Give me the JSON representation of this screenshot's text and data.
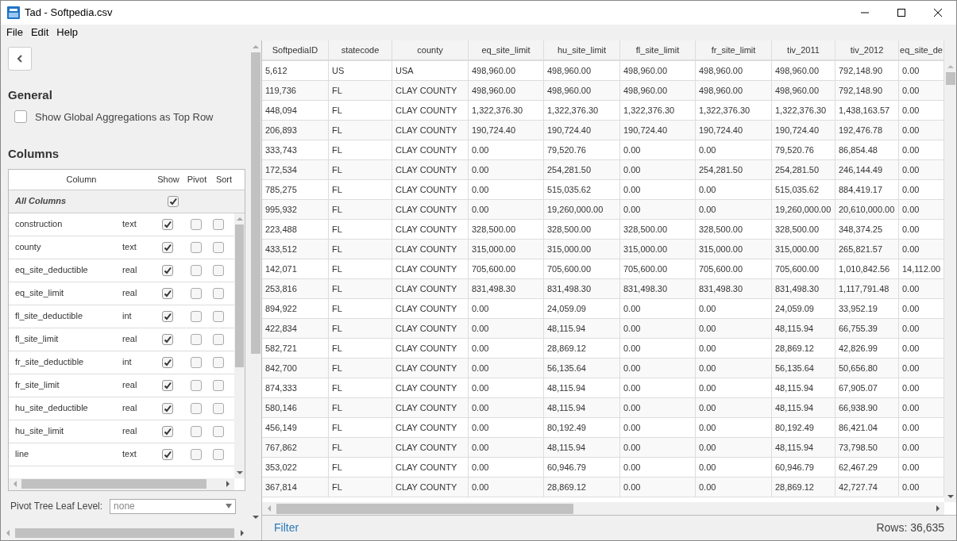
{
  "window": {
    "title": "Tad - Softpedia.csv"
  },
  "menu": [
    "File",
    "Edit",
    "Help"
  ],
  "sidebar": {
    "general": {
      "heading": "General",
      "option": {
        "label": "Show Global Aggregations as Top Row",
        "checked": false
      }
    },
    "columns": {
      "heading": "Columns",
      "headers": [
        "Column",
        "Show",
        "Pivot",
        "Sort"
      ],
      "all": {
        "label": "All Columns",
        "show": true
      },
      "items": [
        {
          "name": "construction",
          "type": "text",
          "show": true,
          "pivot": false,
          "sort": false
        },
        {
          "name": "county",
          "type": "text",
          "show": true,
          "pivot": false,
          "sort": false
        },
        {
          "name": "eq_site_deductible",
          "type": "real",
          "show": true,
          "pivot": false,
          "sort": false
        },
        {
          "name": "eq_site_limit",
          "type": "real",
          "show": true,
          "pivot": false,
          "sort": false
        },
        {
          "name": "fl_site_deductible",
          "type": "int",
          "show": true,
          "pivot": false,
          "sort": false
        },
        {
          "name": "fl_site_limit",
          "type": "real",
          "show": true,
          "pivot": false,
          "sort": false
        },
        {
          "name": "fr_site_deductible",
          "type": "int",
          "show": true,
          "pivot": false,
          "sort": false
        },
        {
          "name": "fr_site_limit",
          "type": "real",
          "show": true,
          "pivot": false,
          "sort": false
        },
        {
          "name": "hu_site_deductible",
          "type": "real",
          "show": true,
          "pivot": false,
          "sort": false
        },
        {
          "name": "hu_site_limit",
          "type": "real",
          "show": true,
          "pivot": false,
          "sort": false
        },
        {
          "name": "line",
          "type": "text",
          "show": true,
          "pivot": false,
          "sort": false
        }
      ]
    },
    "leaf_level": {
      "label": "Pivot Tree Leaf Level:",
      "value": "none"
    }
  },
  "table": {
    "columns": [
      "SoftpediaID",
      "statecode",
      "county",
      "eq_site_limit",
      "hu_site_limit",
      "fl_site_limit",
      "fr_site_limit",
      "tiv_2011",
      "tiv_2012",
      "eq_site_de"
    ],
    "rows": [
      [
        "5,612",
        "US",
        "USA",
        "498,960.00",
        "498,960.00",
        "498,960.00",
        "498,960.00",
        "498,960.00",
        "792,148.90",
        "0.00"
      ],
      [
        "119,736",
        "FL",
        "CLAY COUNTY",
        "498,960.00",
        "498,960.00",
        "498,960.00",
        "498,960.00",
        "498,960.00",
        "792,148.90",
        "0.00"
      ],
      [
        "448,094",
        "FL",
        "CLAY COUNTY",
        "1,322,376.30",
        "1,322,376.30",
        "1,322,376.30",
        "1,322,376.30",
        "1,322,376.30",
        "1,438,163.57",
        "0.00"
      ],
      [
        "206,893",
        "FL",
        "CLAY COUNTY",
        "190,724.40",
        "190,724.40",
        "190,724.40",
        "190,724.40",
        "190,724.40",
        "192,476.78",
        "0.00"
      ],
      [
        "333,743",
        "FL",
        "CLAY COUNTY",
        "0.00",
        "79,520.76",
        "0.00",
        "0.00",
        "79,520.76",
        "86,854.48",
        "0.00"
      ],
      [
        "172,534",
        "FL",
        "CLAY COUNTY",
        "0.00",
        "254,281.50",
        "0.00",
        "254,281.50",
        "254,281.50",
        "246,144.49",
        "0.00"
      ],
      [
        "785,275",
        "FL",
        "CLAY COUNTY",
        "0.00",
        "515,035.62",
        "0.00",
        "0.00",
        "515,035.62",
        "884,419.17",
        "0.00"
      ],
      [
        "995,932",
        "FL",
        "CLAY COUNTY",
        "0.00",
        "19,260,000.00",
        "0.00",
        "0.00",
        "19,260,000.00",
        "20,610,000.00",
        "0.00"
      ],
      [
        "223,488",
        "FL",
        "CLAY COUNTY",
        "328,500.00",
        "328,500.00",
        "328,500.00",
        "328,500.00",
        "328,500.00",
        "348,374.25",
        "0.00"
      ],
      [
        "433,512",
        "FL",
        "CLAY COUNTY",
        "315,000.00",
        "315,000.00",
        "315,000.00",
        "315,000.00",
        "315,000.00",
        "265,821.57",
        "0.00"
      ],
      [
        "142,071",
        "FL",
        "CLAY COUNTY",
        "705,600.00",
        "705,600.00",
        "705,600.00",
        "705,600.00",
        "705,600.00",
        "1,010,842.56",
        "14,112.00"
      ],
      [
        "253,816",
        "FL",
        "CLAY COUNTY",
        "831,498.30",
        "831,498.30",
        "831,498.30",
        "831,498.30",
        "831,498.30",
        "1,117,791.48",
        "0.00"
      ],
      [
        "894,922",
        "FL",
        "CLAY COUNTY",
        "0.00",
        "24,059.09",
        "0.00",
        "0.00",
        "24,059.09",
        "33,952.19",
        "0.00"
      ],
      [
        "422,834",
        "FL",
        "CLAY COUNTY",
        "0.00",
        "48,115.94",
        "0.00",
        "0.00",
        "48,115.94",
        "66,755.39",
        "0.00"
      ],
      [
        "582,721",
        "FL",
        "CLAY COUNTY",
        "0.00",
        "28,869.12",
        "0.00",
        "0.00",
        "28,869.12",
        "42,826.99",
        "0.00"
      ],
      [
        "842,700",
        "FL",
        "CLAY COUNTY",
        "0.00",
        "56,135.64",
        "0.00",
        "0.00",
        "56,135.64",
        "50,656.80",
        "0.00"
      ],
      [
        "874,333",
        "FL",
        "CLAY COUNTY",
        "0.00",
        "48,115.94",
        "0.00",
        "0.00",
        "48,115.94",
        "67,905.07",
        "0.00"
      ],
      [
        "580,146",
        "FL",
        "CLAY COUNTY",
        "0.00",
        "48,115.94",
        "0.00",
        "0.00",
        "48,115.94",
        "66,938.90",
        "0.00"
      ],
      [
        "456,149",
        "FL",
        "CLAY COUNTY",
        "0.00",
        "80,192.49",
        "0.00",
        "0.00",
        "80,192.49",
        "86,421.04",
        "0.00"
      ],
      [
        "767,862",
        "FL",
        "CLAY COUNTY",
        "0.00",
        "48,115.94",
        "0.00",
        "0.00",
        "48,115.94",
        "73,798.50",
        "0.00"
      ],
      [
        "353,022",
        "FL",
        "CLAY COUNTY",
        "0.00",
        "60,946.79",
        "0.00",
        "0.00",
        "60,946.79",
        "62,467.29",
        "0.00"
      ],
      [
        "367,814",
        "FL",
        "CLAY COUNTY",
        "0.00",
        "28,869.12",
        "0.00",
        "0.00",
        "28,869.12",
        "42,727.74",
        "0.00"
      ]
    ]
  },
  "footer": {
    "filter": "Filter",
    "row_count": "Rows: 36,635"
  }
}
